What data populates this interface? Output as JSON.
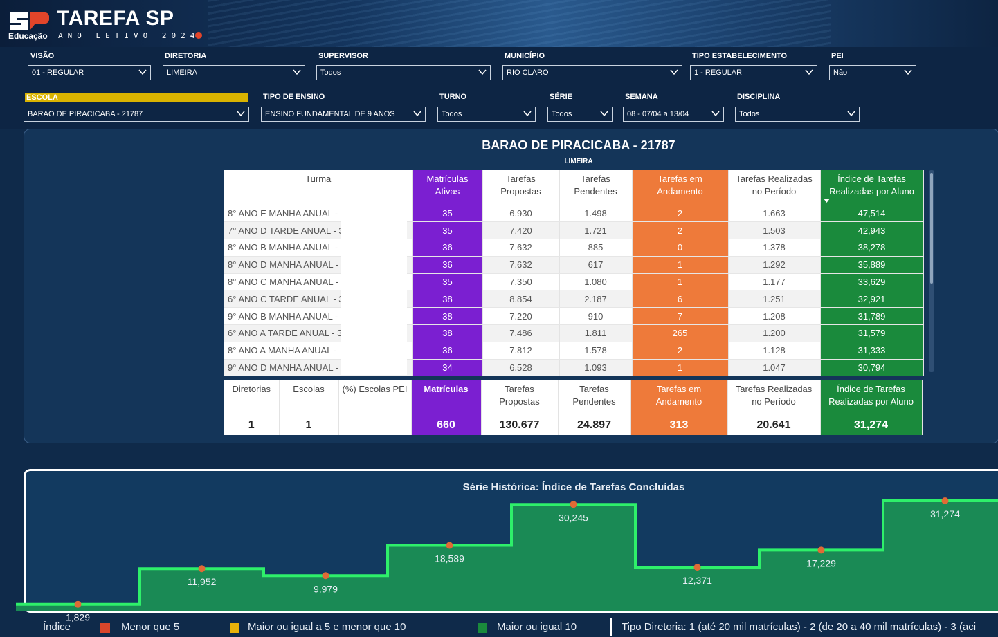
{
  "header": {
    "title": "TAREFA SP",
    "subtitle": "Educação",
    "year_label": "ANO LETIVO 2024",
    "colors": {
      "logo_red": "#e2452a",
      "logo_white": "#ffffff"
    }
  },
  "filters": {
    "visao": {
      "label": "VISÃO",
      "value": "01 - REGULAR"
    },
    "diretoria": {
      "label": "DIRETORIA",
      "value": "LIMEIRA"
    },
    "supervisor": {
      "label": "SUPERVISOR",
      "value": "Todos"
    },
    "municipio": {
      "label": "MUNICÍPIO",
      "value": "RIO CLARO"
    },
    "tipo_estabelecimento": {
      "label": "TIPO ESTABELECIMENTO",
      "value": "1 - REGULAR"
    },
    "pei": {
      "label": "PEI",
      "value": "Não"
    },
    "escola": {
      "label": "ESCOLA",
      "value": "BARAO DE PIRACICABA - 21787"
    },
    "tipo_ensino": {
      "label": "TIPO DE ENSINO",
      "value": "ENSINO FUNDAMENTAL DE 9 ANOS"
    },
    "turno": {
      "label": "TURNO",
      "value": "Todos"
    },
    "serie": {
      "label": "SÉRIE",
      "value": "Todos"
    },
    "semana": {
      "label": "SEMANA",
      "value": "08 - 07/04 a 13/04"
    },
    "disciplina": {
      "label": "DISCIPLINA",
      "value": "Todos"
    }
  },
  "school": {
    "name": "BARAO DE PIRACICABA - 21787",
    "diretoria": "LIMEIRA"
  },
  "table": {
    "headers": {
      "turma": "Turma",
      "matriculas_1": "Matrículas",
      "matriculas_2": "Ativas",
      "propostas_1": "Tarefas",
      "propostas_2": "Propostas",
      "pendentes_1": "Tarefas",
      "pendentes_2": "Pendentes",
      "andamento_1": "Tarefas em",
      "andamento_2": "Andamento",
      "realizadas_1": "Tarefas Realizadas",
      "realizadas_2": "no Período",
      "indice_1": "Índice de Tarefas",
      "indice_2": "Realizadas por Aluno"
    },
    "rows": [
      {
        "turma": "8° ANO E MANHA ANUAL -",
        "matriculas": "35",
        "propostas": "6.930",
        "pendentes": "1.498",
        "andamento": "2",
        "realizadas": "1.663",
        "indice": "47,514"
      },
      {
        "turma": "7° ANO D TARDE ANUAL - 3",
        "matriculas": "35",
        "propostas": "7.420",
        "pendentes": "1.721",
        "andamento": "2",
        "realizadas": "1.503",
        "indice": "42,943"
      },
      {
        "turma": "8° ANO B MANHA ANUAL -",
        "matriculas": "36",
        "propostas": "7.632",
        "pendentes": "885",
        "andamento": "0",
        "realizadas": "1.378",
        "indice": "38,278"
      },
      {
        "turma": "8° ANO D MANHA ANUAL -",
        "matriculas": "36",
        "propostas": "7.632",
        "pendentes": "617",
        "andamento": "1",
        "realizadas": "1.292",
        "indice": "35,889"
      },
      {
        "turma": "8° ANO C MANHA ANUAL -",
        "matriculas": "35",
        "propostas": "7.350",
        "pendentes": "1.080",
        "andamento": "1",
        "realizadas": "1.177",
        "indice": "33,629"
      },
      {
        "turma": "6° ANO C TARDE ANUAL - 3",
        "matriculas": "38",
        "propostas": "8.854",
        "pendentes": "2.187",
        "andamento": "6",
        "realizadas": "1.251",
        "indice": "32,921"
      },
      {
        "turma": "9° ANO B MANHA ANUAL -",
        "matriculas": "38",
        "propostas": "7.220",
        "pendentes": "910",
        "andamento": "7",
        "realizadas": "1.208",
        "indice": "31,789"
      },
      {
        "turma": "6° ANO A TARDE ANUAL - 3",
        "matriculas": "38",
        "propostas": "7.486",
        "pendentes": "1.811",
        "andamento": "265",
        "realizadas": "1.200",
        "indice": "31,579"
      },
      {
        "turma": "8° ANO A MANHA ANUAL -",
        "matriculas": "36",
        "propostas": "7.812",
        "pendentes": "1.578",
        "andamento": "2",
        "realizadas": "1.128",
        "indice": "31,333"
      },
      {
        "turma": "9° ANO D MANHA ANUAL -",
        "matriculas": "34",
        "propostas": "6.528",
        "pendentes": "1.093",
        "andamento": "1",
        "realizadas": "1.047",
        "indice": "30,794"
      }
    ]
  },
  "totals": {
    "headers": {
      "diretorias": "Diretorias",
      "escolas": "Escolas",
      "pei": "(%) Escolas PEI",
      "matriculas": "Matrículas",
      "propostas_1": "Tarefas",
      "propostas_2": "Propostas",
      "pendentes_1": "Tarefas",
      "pendentes_2": "Pendentes",
      "andamento_1": "Tarefas em",
      "andamento_2": "Andamento",
      "realizadas_1": "Tarefas Realizadas",
      "realizadas_2": "no Período",
      "indice_1": "Índice de Tarefas",
      "indice_2": "Realizadas por Aluno"
    },
    "values": {
      "diretorias": "1",
      "escolas": "1",
      "pei": "",
      "matriculas": "660",
      "propostas": "130.677",
      "pendentes": "24.897",
      "andamento": "313",
      "realizadas": "20.641",
      "indice": "31,274"
    }
  },
  "chart_data": {
    "type": "area",
    "title": "Série Histórica: Índice de Tarefas Concluídas",
    "step": true,
    "points": [
      {
        "label": "1,829",
        "value": 1.829
      },
      {
        "label": "11,952",
        "value": 11.952
      },
      {
        "label": "9,979",
        "value": 9.979
      },
      {
        "label": "18,589",
        "value": 18.589
      },
      {
        "label": "30,245",
        "value": 30.245
      },
      {
        "label": "12,371",
        "value": 12.371
      },
      {
        "label": "17,229",
        "value": 17.229
      },
      {
        "label": "31,274",
        "value": 31.274
      }
    ],
    "ylim": [
      0,
      36
    ],
    "colors": {
      "line": "#2ef06a",
      "fill": "#1a8a55",
      "marker": "#e06a35",
      "label": "#e8eef5"
    }
  },
  "legend": {
    "title": "Índice",
    "items": [
      {
        "label": "Menor que 5",
        "color": "#d8462b"
      },
      {
        "label": "Maior ou igual a 5 e menor que 10",
        "color": "#e8b20a"
      },
      {
        "label": "Maior ou igual 10",
        "color": "#1a8a3c"
      }
    ],
    "note": "Tipo Diretoria: 1 (até 20 mil matrículas) - 2 (de 20 a 40 mil matrículas) - 3 (aci"
  }
}
